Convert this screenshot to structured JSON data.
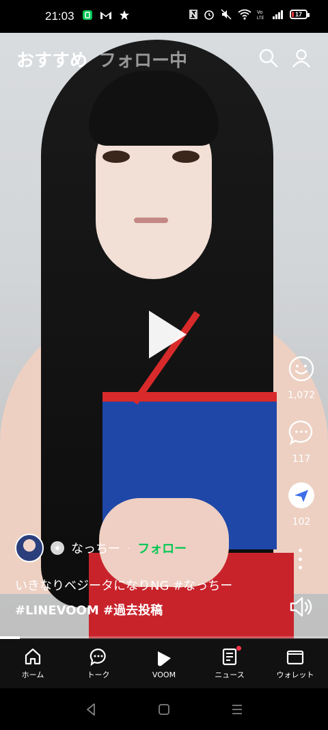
{
  "status_bar": {
    "time": "21:03",
    "battery_level": "17",
    "battery_color": "#e53935"
  },
  "top_tabs": {
    "recommended": "おすすめ",
    "following": "フォロー中"
  },
  "actions": {
    "like_count": "1,072",
    "comment_count": "117",
    "share_count": "102",
    "share_color": "#3d6fe8"
  },
  "post": {
    "author": "なっちー",
    "separator": "·",
    "follow_label": "フォロー",
    "follow_color": "#06c755",
    "caption": "いきなりベジータになりNG #なっちー",
    "tags": "#LINEVOOM #過去投稿",
    "progress_fraction": 0.06
  },
  "bottom_nav": {
    "items": [
      {
        "label": "ホーム",
        "icon": "home-icon"
      },
      {
        "label": "トーク",
        "icon": "chat-icon"
      },
      {
        "label": "VOOM",
        "icon": "voom-icon"
      },
      {
        "label": "ニュース",
        "icon": "news-icon"
      },
      {
        "label": "ウォレット",
        "icon": "wallet-icon"
      }
    ]
  }
}
